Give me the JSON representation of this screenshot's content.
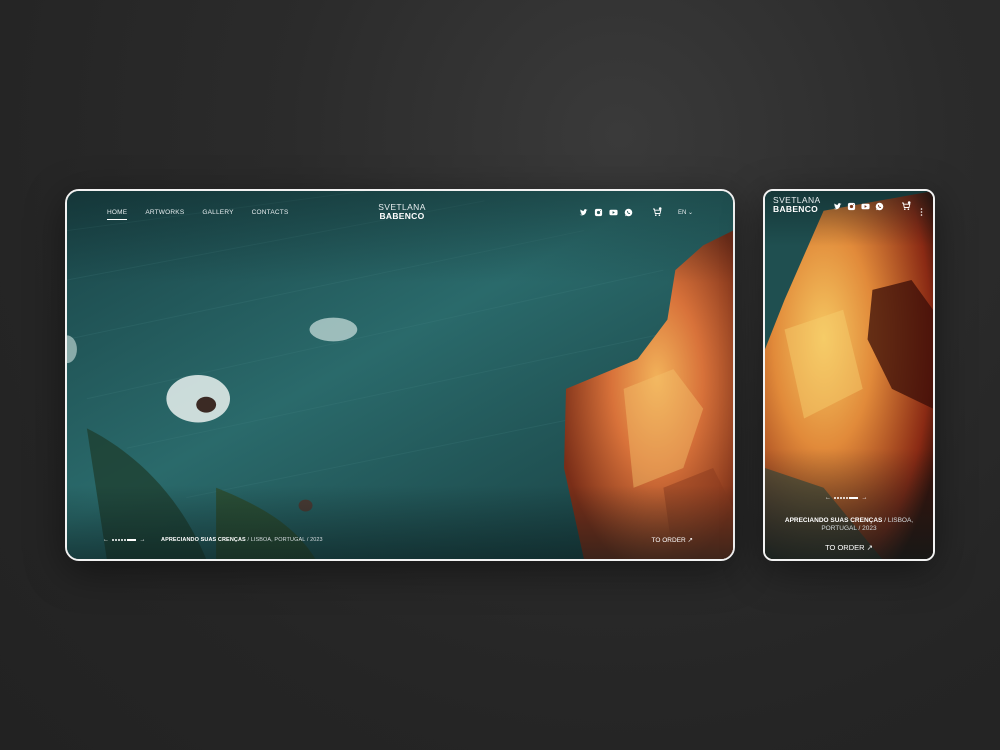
{
  "brand": {
    "line1": "SVETLANA",
    "line2": "BABENCO"
  },
  "nav": {
    "items": [
      "HOME",
      "ARTWORKS",
      "GALLERY",
      "CONTACTS"
    ],
    "active": "HOME"
  },
  "socials": [
    "twitter-icon",
    "instagram-icon",
    "youtube-icon",
    "whatsapp-icon"
  ],
  "language": {
    "label": "EN",
    "chevron": "⌄"
  },
  "slider": {
    "prev": "←",
    "next": "→"
  },
  "artwork": {
    "title": "APRECIANDO SUAS CRENÇAS",
    "separator": " / ",
    "location": "LISBOA, PORTUGAL",
    "location_mobile_1": "LISBOA,",
    "location_mobile_2": "PORTUGAL",
    "year": "2023"
  },
  "cta": {
    "label": "TO ORDER",
    "icon": "↗"
  },
  "colors": {
    "background": "#2a2a2a",
    "frame_border": "#f2f2f2",
    "sea": "#1f5556",
    "cliff": "#d77a3a"
  }
}
